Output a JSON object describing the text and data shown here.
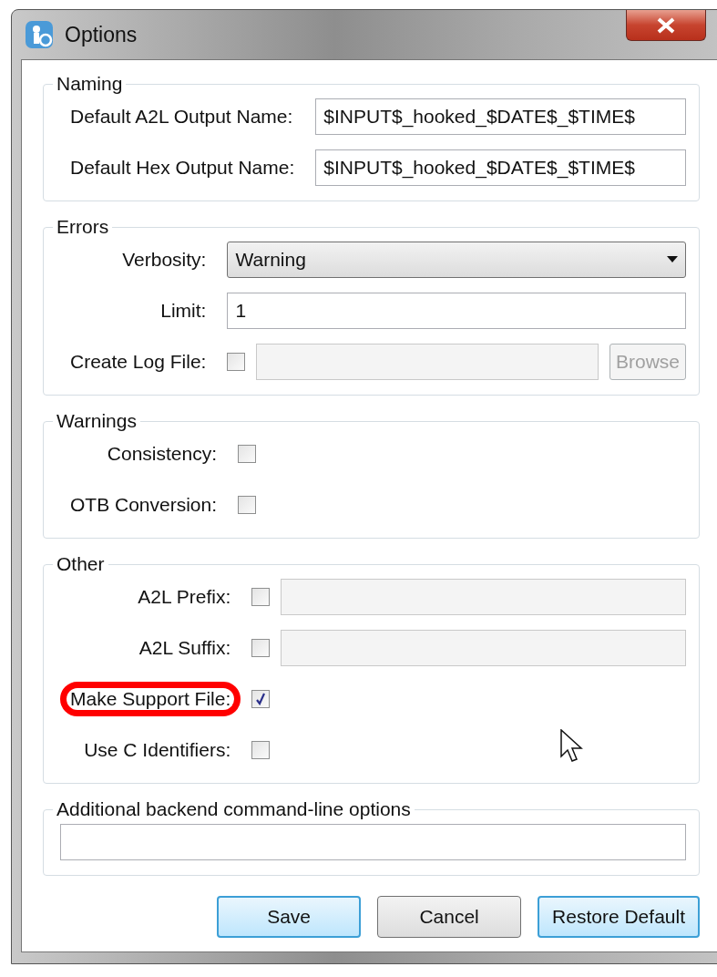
{
  "window": {
    "title": "Options"
  },
  "groups": [
    {
      "title": "Naming",
      "rows": [
        {
          "kind": "text",
          "label": "Default A2L Output Name:",
          "value": "$INPUT$_hooked_$DATE$_$TIME$"
        },
        {
          "kind": "text",
          "label": "Default Hex Output Name:",
          "value": "$INPUT$_hooked_$DATE$_$TIME$"
        }
      ]
    },
    {
      "title": "Errors",
      "rows": [
        {
          "kind": "dropdown",
          "label": "Verbosity:",
          "value": "Warning"
        },
        {
          "kind": "text",
          "label": "Limit:",
          "value": "1"
        },
        {
          "kind": "check_file",
          "label": "Create Log File:",
          "checked": false,
          "button": "Browse",
          "disabled": true
        }
      ]
    },
    {
      "title": "Warnings",
      "rows": [
        {
          "kind": "checkbox",
          "label": "Consistency:",
          "checked": false
        },
        {
          "kind": "checkbox",
          "label": "OTB Conversion:",
          "checked": false
        }
      ]
    },
    {
      "title": "Other",
      "rows": [
        {
          "kind": "check_text",
          "label": "A2L Prefix:",
          "checked": false
        },
        {
          "kind": "check_text",
          "label": "A2L Suffix:",
          "checked": false
        },
        {
          "kind": "checkbox",
          "label": "Make Support File:",
          "checked": true,
          "highlighted": true
        },
        {
          "kind": "checkbox",
          "label": "Use C Identifiers:",
          "checked": false
        }
      ]
    },
    {
      "title": "Additional backend command-line options",
      "rows": [
        {
          "kind": "wide_text"
        }
      ]
    }
  ],
  "buttons": [
    {
      "label": "Save",
      "focused": true
    },
    {
      "label": "Cancel",
      "focused": false
    },
    {
      "label": "Restore Default",
      "focused": true
    }
  ]
}
